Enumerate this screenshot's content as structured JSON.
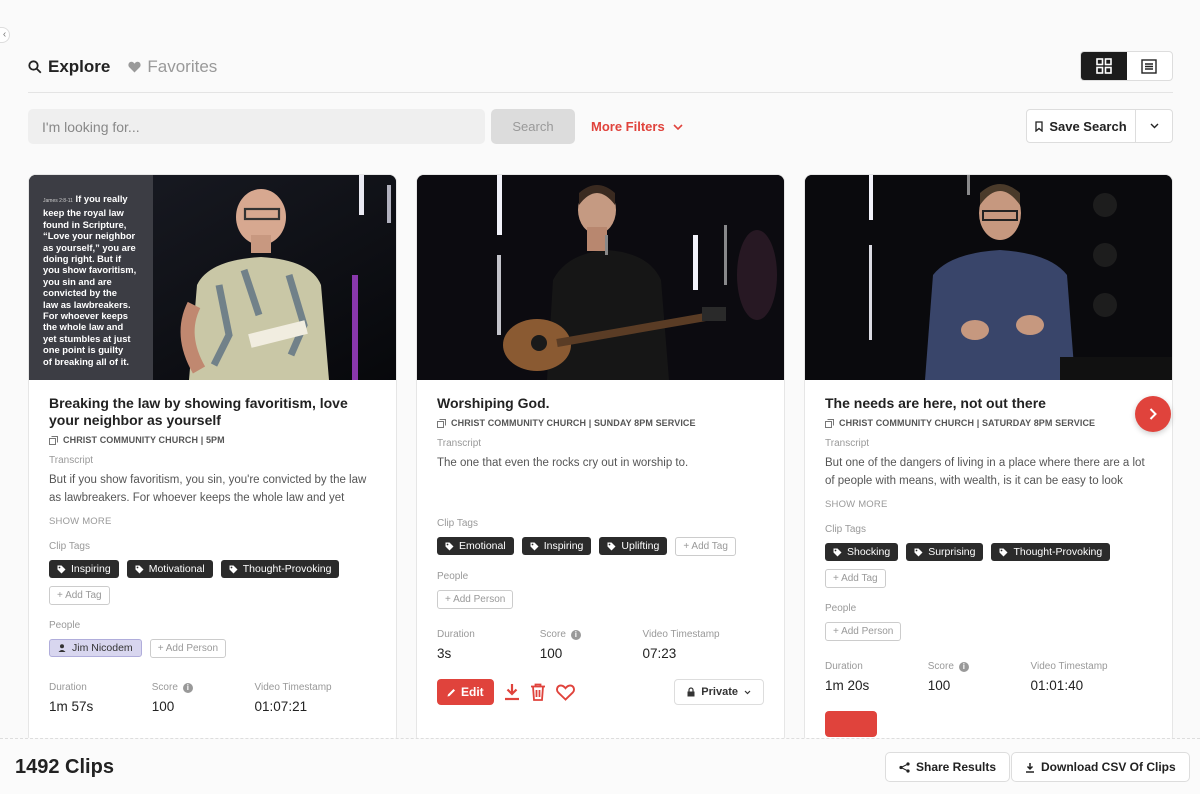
{
  "nav": {
    "explore_label": "Explore",
    "favorites_label": "Favorites"
  },
  "search": {
    "placeholder": "I'm looking for...",
    "button_label": "Search",
    "more_filters_label": "More Filters",
    "save_search_label": "Save Search"
  },
  "cards": [
    {
      "title": "Breaking the law by showing favoritism, love your neighbor as yourself",
      "meta": "CHRIST COMMUNITY CHURCH | 5PM",
      "transcript_label": "Transcript",
      "transcript": "But if you show favoritism, you sin, you're convicted by the law as lawbreakers. For whoever keeps the whole law and yet",
      "show_more": "SHOW MORE",
      "clip_tags_label": "Clip Tags",
      "tags": [
        "Inspiring",
        "Motivational",
        "Thought-Provoking"
      ],
      "add_tag": "+ Add Tag",
      "people_label": "People",
      "person": "Jim Nicodem",
      "add_person": "+ Add Person",
      "duration_label": "Duration",
      "duration": "1m 57s",
      "score_label": "Score",
      "score": "100",
      "timestamp_label": "Video Timestamp",
      "timestamp": "01:07:21",
      "slide": {
        "ref": "James 2:8-11",
        "lines": [
          "If you really",
          "keep the royal law",
          "found in Scripture,",
          "“Love your neighbor",
          "as yourself,” you are",
          "doing right. But if",
          "you show favoritism,",
          "you sin and are",
          "convicted by the",
          "law as lawbreakers.",
          "For whoever keeps",
          "the whole law and",
          "yet stumbles at just",
          "one point is guilty",
          "of breaking all of it."
        ]
      }
    },
    {
      "title": "Worshiping God.",
      "meta": "CHRIST COMMUNITY CHURCH | SUNDAY 8PM SERVICE",
      "transcript_label": "Transcript",
      "transcript": "The one that even the rocks cry out in worship to.",
      "clip_tags_label": "Clip Tags",
      "tags": [
        "Emotional",
        "Inspiring",
        "Uplifting"
      ],
      "add_tag": "+ Add Tag",
      "people_label": "People",
      "add_person": "+ Add Person",
      "duration_label": "Duration",
      "duration": "3s",
      "score_label": "Score",
      "score": "100",
      "timestamp_label": "Video Timestamp",
      "timestamp": "07:23",
      "edit_label": "Edit",
      "privacy_label": "Private"
    },
    {
      "title": "The needs are here, not out there",
      "meta": "CHRIST COMMUNITY CHURCH | SATURDAY 8PM SERVICE",
      "transcript_label": "Transcript",
      "transcript": "But one of the dangers of living in a place where there are a lot of people with means, with wealth, is it can be easy to look",
      "show_more": "SHOW MORE",
      "clip_tags_label": "Clip Tags",
      "tags": [
        "Shocking",
        "Surprising",
        "Thought-Provoking"
      ],
      "add_tag": "+ Add Tag",
      "people_label": "People",
      "add_person": "+ Add Person",
      "duration_label": "Duration",
      "duration": "1m 20s",
      "score_label": "Score",
      "score": "100",
      "timestamp_label": "Video Timestamp",
      "timestamp": "01:01:40"
    }
  ],
  "footer": {
    "clip_count": "1492 Clips",
    "share_label": "Share Results",
    "download_label": "Download CSV Of Clips"
  },
  "colors": {
    "accent": "#e0433c",
    "tag_bg": "#2b2b2b",
    "person_bg": "#d8d6ef"
  }
}
